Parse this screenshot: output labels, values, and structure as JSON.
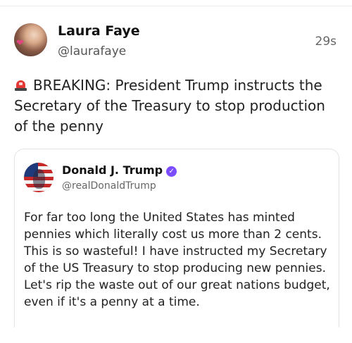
{
  "post": {
    "author_name": "Laura Faye",
    "author_handle": "@laurafaye",
    "timestamp": "29s",
    "text": "BREAKING: President Trump instructs the Secretary of the Treasury to stop production of the penny",
    "leading_icon": "police-siren-icon"
  },
  "quoted_post": {
    "author_name": "Donald J. Trump",
    "author_handle": "@realDonaldTrump",
    "verified": true,
    "badge_color": "#7b4dff",
    "text": "For far too long the United States has minted pennies which literally cost us more than 2 cents. This is so wasteful! I have instructed my Secretary of the US Treasury to stop producing new pennies. Let's rip the waste out of our great nations budget, even if it's a penny at a time."
  },
  "colors": {
    "text": "#222222",
    "muted": "#666666",
    "border": "#e3e3e3",
    "siren_red": "#e53935"
  }
}
